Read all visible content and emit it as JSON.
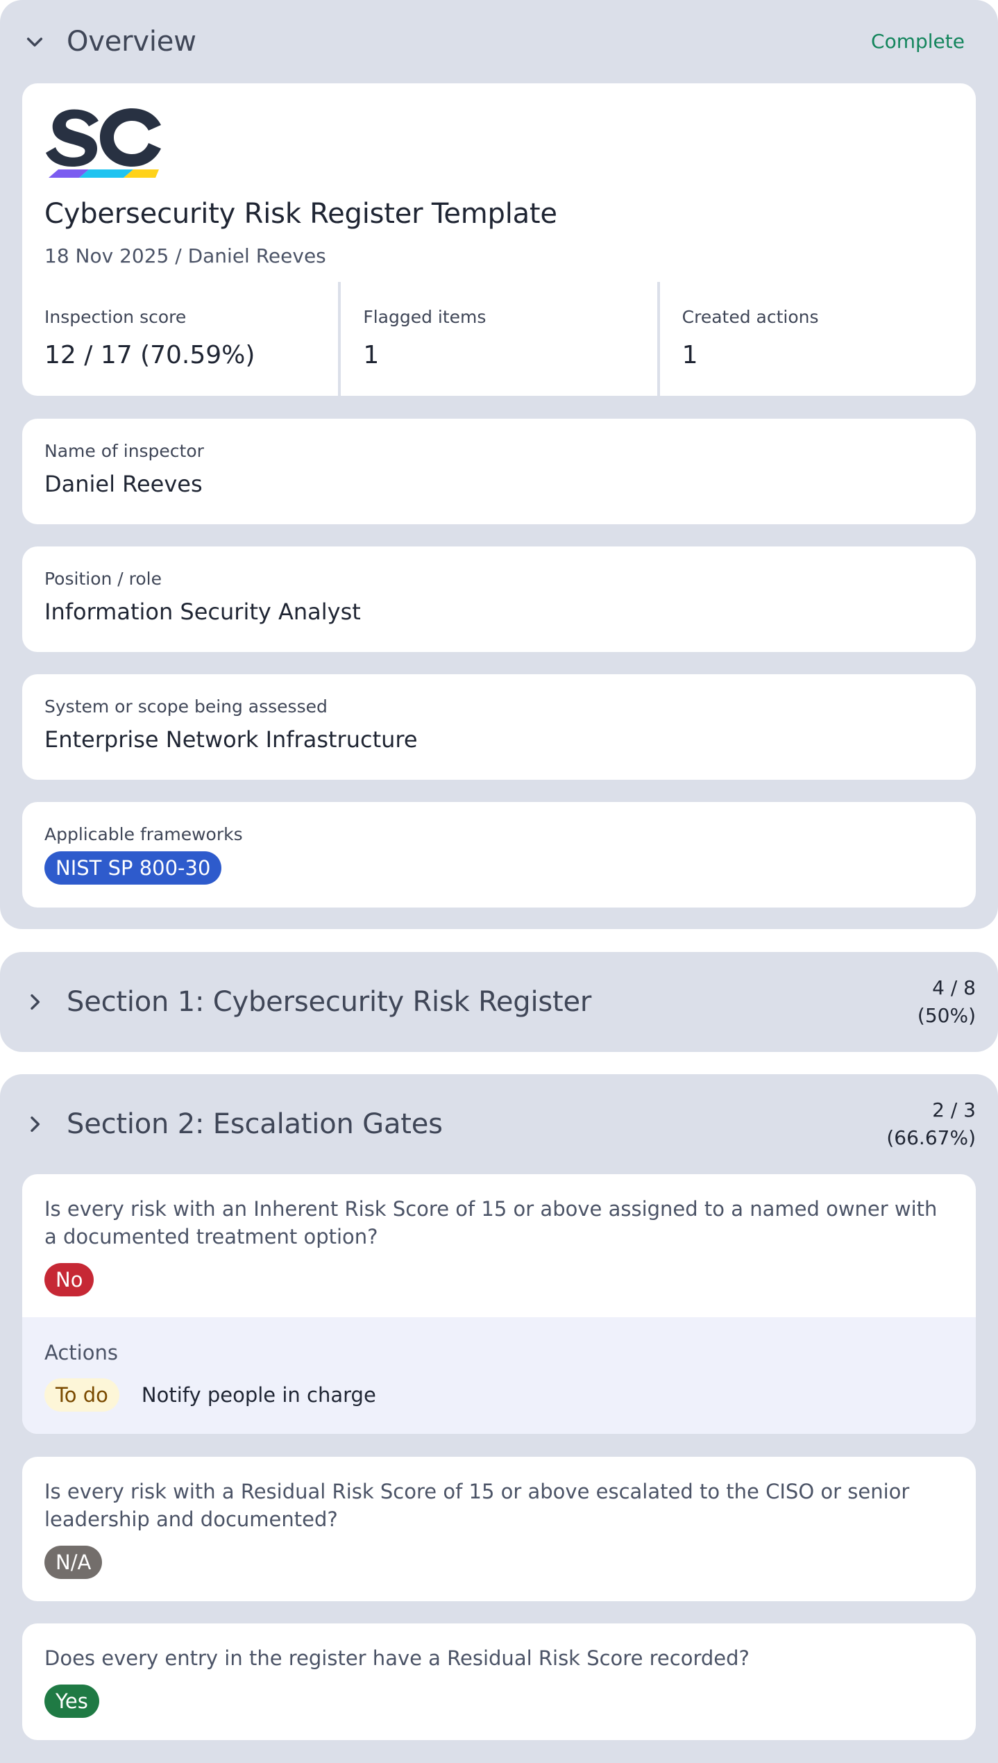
{
  "overview": {
    "title": "Overview",
    "status": "Complete",
    "doc_title": "Cybersecurity Risk Register Template",
    "doc_meta": "18 Nov 2025 / Daniel Reeves",
    "stats": [
      {
        "label": "Inspection score",
        "value": "12 / 17 (70.59%)"
      },
      {
        "label": "Flagged items",
        "value": "1"
      },
      {
        "label": "Created actions",
        "value": "1"
      }
    ],
    "fields": [
      {
        "label": "Name of inspector",
        "value": "Daniel Reeves"
      },
      {
        "label": "Position / role",
        "value": "Information Security Analyst"
      },
      {
        "label": "System or scope being assessed",
        "value": "Enterprise Network Infrastructure"
      }
    ],
    "frameworks": {
      "label": "Applicable frameworks",
      "tag": "NIST SP 800-30"
    }
  },
  "section1": {
    "title": "Section 1: Cybersecurity Risk Register",
    "score_line1": "4 / 8",
    "score_line2": "(50%)"
  },
  "section2": {
    "title": "Section 2: Escalation Gates",
    "score_line1": "2 / 3",
    "score_line2": "(66.67%)",
    "questions": [
      {
        "text": "Is every risk with an Inherent Risk Score of 15 or above assigned to a named owner with a documented treatment option?",
        "answer": "No",
        "actions_title": "Actions",
        "action_status": "To do",
        "action_text": "Notify people in charge"
      },
      {
        "text": "Is every risk with a Residual Risk Score of 15 or above escalated to the CISO or senior leadership and documented?",
        "answer": "N/A"
      },
      {
        "text": "Does every entry in the register have a Residual Risk Score recorded?",
        "answer": "Yes"
      }
    ]
  },
  "colors": {
    "panel_bg": "#dbdfe9",
    "complete_green": "#13855c",
    "framework_blue": "#2e5bcc",
    "no_red": "#c62835",
    "na_gray": "#736e6b",
    "yes_green": "#1f7a44",
    "todo_bg": "#fdf6d8"
  },
  "icons": {
    "collapse": "chevron-down-icon",
    "expand": "chevron-right-icon",
    "logo": "sc-logo"
  }
}
